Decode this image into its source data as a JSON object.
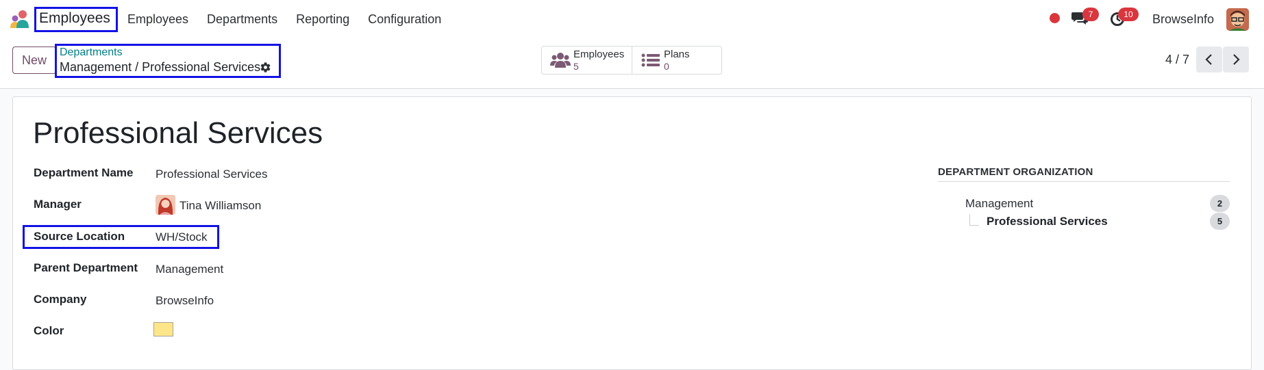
{
  "navbar": {
    "app_name": "Employees",
    "menu": [
      "Employees",
      "Departments",
      "Reporting",
      "Configuration"
    ],
    "messages_count": "7",
    "activities_count": "10",
    "company": "BrowseInfo",
    "record_dot_color": "#d9363e"
  },
  "control_panel": {
    "new_label": "New",
    "breadcrumb_parent": "Departments",
    "breadcrumb_current": "Management / Professional Services",
    "smart_buttons": [
      {
        "label": "Employees",
        "value": "5",
        "icon": "users-icon"
      },
      {
        "label": "Plans",
        "value": "0",
        "icon": "list-icon"
      }
    ],
    "pager": "4 / 7"
  },
  "form": {
    "title": "Professional Services",
    "fields": [
      {
        "label": "Department Name",
        "value": "Professional Services"
      },
      {
        "label": "Manager",
        "value": "Tina Williamson"
      },
      {
        "label": "Source Location",
        "value": "WH/Stock"
      },
      {
        "label": "Parent Department",
        "value": "Management"
      },
      {
        "label": "Company",
        "value": "BrowseInfo"
      },
      {
        "label": "Color",
        "value": "#fde68a"
      }
    ]
  },
  "organization": {
    "heading": "DEPARTMENT ORGANIZATION",
    "items": [
      {
        "name": "Management",
        "count": "2"
      },
      {
        "name": "Professional Services",
        "count": "5"
      }
    ]
  },
  "colors": {
    "brand": "#714b67",
    "link": "#017e84",
    "highlight": "#1212e6",
    "badge": "#d9363e"
  }
}
